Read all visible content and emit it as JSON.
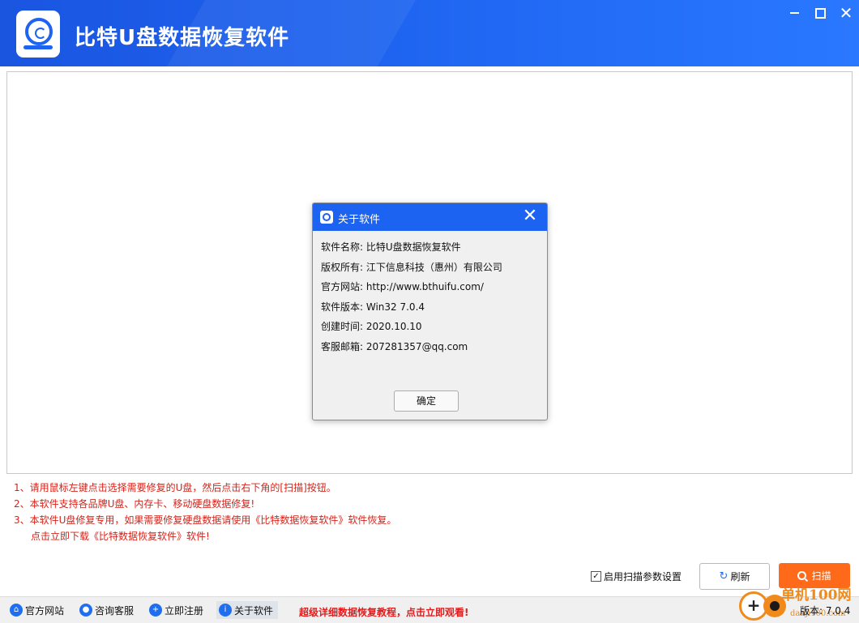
{
  "app": {
    "title": "比特U盘数据恢复软件"
  },
  "window_controls": {
    "minimize": "—",
    "maximize": "☐",
    "close": "✕"
  },
  "dialog": {
    "title": "关于软件",
    "close": "✕",
    "rows": [
      "软件名称: 比特U盘数据恢复软件",
      "版权所有: 江下信息科技（惠州）有限公司",
      "官方网站: http://www.bthuifu.com/",
      "软件版本: Win32 7.0.4",
      "创建时间: 2020.10.10",
      "客服邮箱: 207281357@qq.com"
    ],
    "ok_label": "确定"
  },
  "notes": [
    "1、请用鼠标左键点击选择需要修复的U盘，然后点击右下角的[扫描]按钮。",
    "2、本软件支持各品牌U盘、内存卡、移动硬盘数据修复!",
    "3、本软件U盘修复专用，如果需要修复硬盘数据请使用《比特数据恢复软件》软件恢复。",
    "点击立即下载《比特数据恢复软件》软件!"
  ],
  "scan_settings": {
    "label": "启用扫描参数设置",
    "checked": true,
    "check_mark": "✓"
  },
  "buttons": {
    "refresh": "刷新",
    "scan": "扫描"
  },
  "bottom_bar": {
    "items": [
      {
        "label": "官方网站",
        "icon": "home-icon",
        "glyph": "⌂"
      },
      {
        "label": "咨询客服",
        "icon": "chat-icon",
        "glyph": "●"
      },
      {
        "label": "立即注册",
        "icon": "user-icon",
        "glyph": "+"
      },
      {
        "label": "关于软件",
        "icon": "info-icon",
        "glyph": "i"
      }
    ],
    "promo_link": "超级详细数据恢复教程，点击立即观看!",
    "version": "版本: 7.0.4"
  },
  "watermark": {
    "text": "单机100网",
    "sub": "danji100.com",
    "plus": "+"
  },
  "colors": {
    "header_blue": "#1e64f0",
    "dialog_blue": "#1c63f2",
    "note_red": "#d6231a",
    "scan_orange": "#ff6a1a",
    "watermark_orange": "#f08a1a"
  }
}
